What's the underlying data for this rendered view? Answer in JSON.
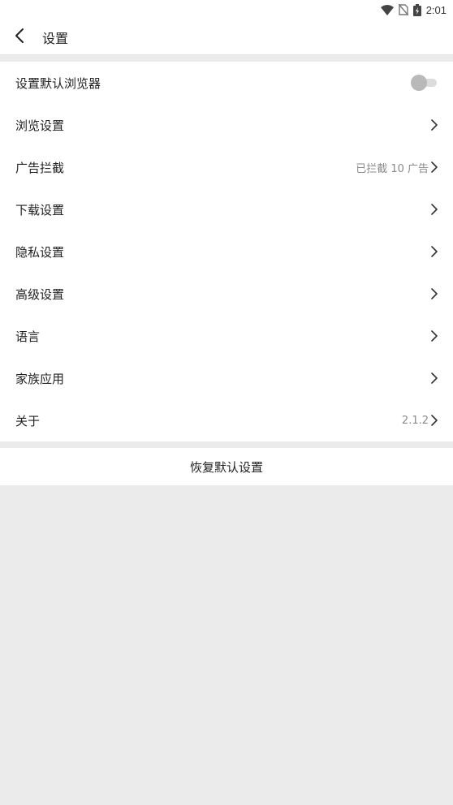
{
  "status_bar": {
    "time": "2:01",
    "icons": [
      "wifi-icon",
      "no-sim-icon",
      "battery-charging-icon"
    ]
  },
  "header": {
    "back_icon": "chevron-left-icon",
    "title": "设置"
  },
  "settings": {
    "default_browser": {
      "label": "设置默认浏览器",
      "toggle_on": false
    },
    "browse": {
      "label": "浏览设置"
    },
    "adblock": {
      "label": "广告拦截",
      "value": "已拦截 10 广告"
    },
    "download": {
      "label": "下载设置"
    },
    "privacy": {
      "label": "隐私设置"
    },
    "advanced": {
      "label": "高级设置"
    },
    "language": {
      "label": "语言"
    },
    "family_apps": {
      "label": "家族应用"
    },
    "about": {
      "label": "关于",
      "value": "2.1.2"
    }
  },
  "reset": {
    "label": "恢复默认设置"
  },
  "colors": {
    "background": "#ebebeb",
    "surface": "#ffffff",
    "text_primary": "#222222",
    "text_secondary": "#8a8a8a"
  }
}
